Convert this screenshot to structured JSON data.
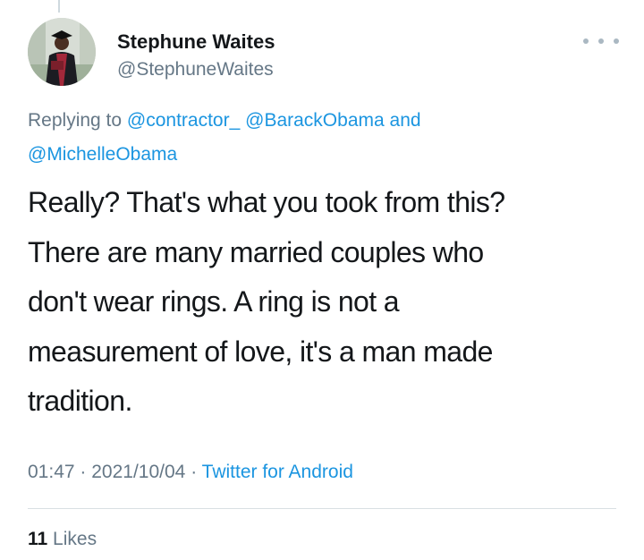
{
  "tweet": {
    "display_name": "Stephune Waites",
    "handle": "@StephuneWaites",
    "replying_to_label": "Replying to",
    "mentions": [
      "@contractor_",
      "@BarackObama",
      "@MichelleObama"
    ],
    "mention_connector": "and",
    "text_lines": [
      "Really? That's what you took from this?",
      "There are many married couples who",
      "don't wear rings. A ring is not a",
      "measurement of love, it's a man made",
      "tradition."
    ],
    "time": "01:47",
    "date": "2021/10/04",
    "separator": "·",
    "source": "Twitter for Android",
    "likes_count": "11",
    "likes_label": "Likes"
  },
  "icons": {
    "avatar": "graduate-photo",
    "more": "more-horizontal-icon"
  },
  "colors": {
    "text": "#14171a",
    "secondary": "#657786",
    "link": "#1b95e0",
    "divider": "#d9dfe3"
  }
}
